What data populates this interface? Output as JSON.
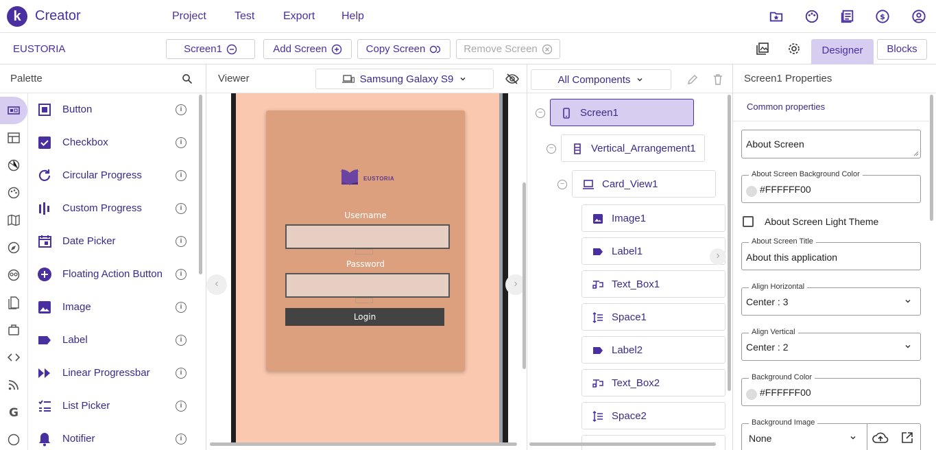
{
  "app": {
    "logo_letter": "k",
    "brand": "Creator"
  },
  "menu": [
    "Project",
    "Test",
    "Export",
    "Help"
  ],
  "top_icons": [
    "folder-star-icon",
    "palette-icon",
    "news-icon",
    "dollar-icon",
    "account-icon"
  ],
  "toolbar": {
    "project_name": "EUSTORIA",
    "screen_select": "Screen1",
    "add_screen": "Add Screen",
    "copy_screen": "Copy Screen",
    "remove_screen": "Remove Screen",
    "designer": "Designer",
    "blocks": "Blocks"
  },
  "palette": {
    "title": "Palette",
    "categories": [
      "user-interface-icon",
      "layout-icon",
      "media-icon",
      "drawing-icon",
      "maps-icon",
      "sensors-icon",
      "social-icon",
      "storage-icon",
      "connectivity-icon",
      "extension-icon",
      "feed-icon",
      "google-icon",
      "more-icon"
    ],
    "items": [
      {
        "label": "Button",
        "icon": "button-icon",
        "info": "i"
      },
      {
        "label": "Checkbox",
        "icon": "checkbox-icon",
        "info": "i"
      },
      {
        "label": "Circular Progress",
        "icon": "circular-progress-icon",
        "info": "i"
      },
      {
        "label": "Custom Progress",
        "icon": "custom-progress-icon",
        "info": "i"
      },
      {
        "label": "Date Picker",
        "icon": "date-picker-icon",
        "info": "i"
      },
      {
        "label": "Floating Action Button",
        "icon": "fab-icon",
        "info": "i"
      },
      {
        "label": "Image",
        "icon": "image-icon",
        "info": "i"
      },
      {
        "label": "Label",
        "icon": "label-icon",
        "info": "i"
      },
      {
        "label": "Linear Progressbar",
        "icon": "linear-progress-icon",
        "info": "i"
      },
      {
        "label": "List Picker",
        "icon": "list-picker-icon",
        "info": "i"
      },
      {
        "label": "Notifier",
        "icon": "notifier-icon",
        "info": "i"
      }
    ]
  },
  "viewer": {
    "title": "Viewer",
    "device": "Samsung Galaxy S9",
    "app_screen": {
      "logo_text": "EUSTORIA",
      "username_label": "Username",
      "password_label": "Password",
      "login_button": "Login"
    },
    "nav_prev": "‹",
    "nav_next": "›"
  },
  "components": {
    "filter": "All Components",
    "tree": [
      {
        "label": "Screen1",
        "icon": "phone-icon",
        "selected": true
      },
      {
        "label": "Vertical_Arrangement1",
        "icon": "vertical-arrangement-icon"
      },
      {
        "label": "Card_View1",
        "icon": "card-view-icon"
      },
      {
        "label": "Image1",
        "icon": "image-icon"
      },
      {
        "label": "Label1",
        "icon": "label-icon"
      },
      {
        "label": "Text_Box1",
        "icon": "textbox-icon"
      },
      {
        "label": "Space1",
        "icon": "space-icon"
      },
      {
        "label": "Label2",
        "icon": "label-icon"
      },
      {
        "label": "Text_Box2",
        "icon": "textbox-icon"
      },
      {
        "label": "Space2",
        "icon": "space-icon"
      }
    ],
    "collapse_symbol": "−",
    "nav_next": "›"
  },
  "properties": {
    "title": "Screen1 Properties",
    "section": "Common properties",
    "about_screen": "About Screen",
    "about_bg_color_label": "About Screen Background Color",
    "about_bg_color_value": "#FFFFFF00",
    "light_theme_label": "About Screen Light Theme",
    "about_title_label": "About Screen Title",
    "about_title_value": "About this application",
    "align_h_label": "Align Horizontal",
    "align_h_value": "Center : 3",
    "align_v_label": "Align Vertical",
    "align_v_value": "Center : 2",
    "bg_color_label": "Background Color",
    "bg_color_value": "#FFFFFF00",
    "bg_image_label": "Background Image",
    "bg_image_value": "None"
  },
  "colors": {
    "brand": "#4a2fa0",
    "accent_light": "#d6cdf0",
    "screen_bg": "#f9c8ae",
    "card_bg": "#dca07e",
    "login_button": "#434343"
  }
}
